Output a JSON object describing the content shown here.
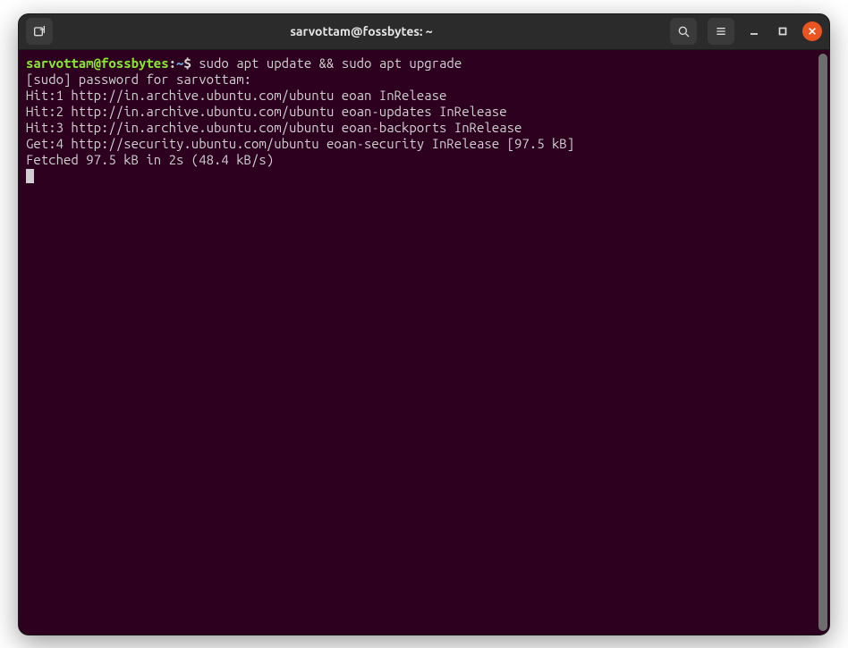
{
  "titlebar": {
    "title": "sarvottam@fossbytes: ~"
  },
  "prompt": {
    "user_host": "sarvottam@fossbytes",
    "sep1": ":",
    "path": "~",
    "sep2": "$ "
  },
  "command": "sudo apt update && sudo apt upgrade",
  "output": {
    "line1": "[sudo] password for sarvottam:",
    "line2": "Hit:1 http://in.archive.ubuntu.com/ubuntu eoan InRelease",
    "line3": "Hit:2 http://in.archive.ubuntu.com/ubuntu eoan-updates InRelease",
    "line4": "Hit:3 http://in.archive.ubuntu.com/ubuntu eoan-backports InRelease",
    "line5": "Get:4 http://security.ubuntu.com/ubuntu eoan-security InRelease [97.5 kB]",
    "line6": "Fetched 97.5 kB in 2s (48.4 kB/s)"
  }
}
